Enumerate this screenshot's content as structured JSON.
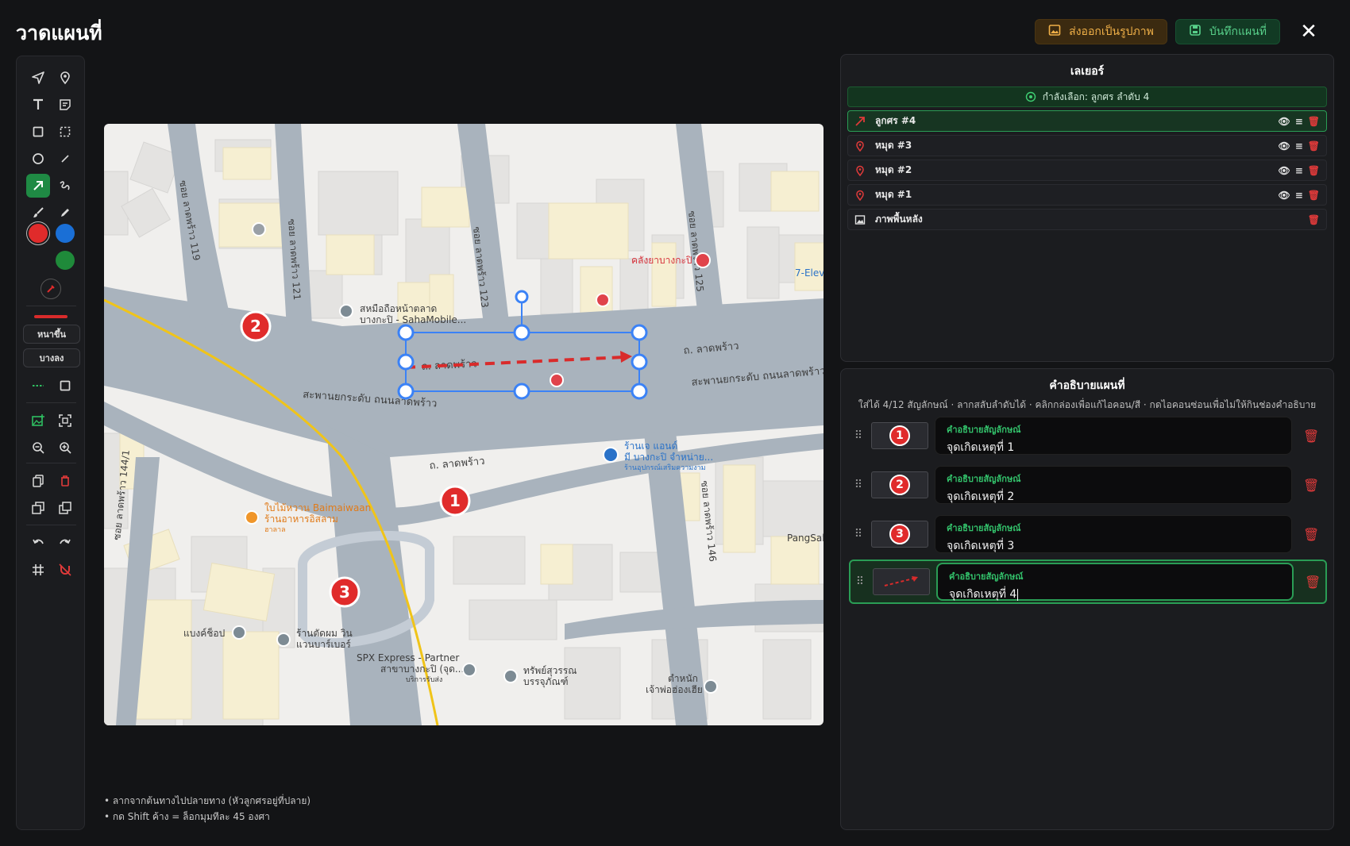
{
  "app": {
    "title": "วาดแผนที่",
    "export_label": "ส่งออกเป็นรูปภาพ",
    "save_label": "บันทึกแผนที่",
    "close_label": "✕"
  },
  "toolbar": {
    "thickness_label": "หนาขึ้น",
    "thin_label": "บางลง",
    "colors": [
      "#e02b2b",
      "#1a6fd6",
      "#1f8a3a"
    ],
    "line_color": "#d92b2b"
  },
  "hints": [
    "• ลากจากต้นทางไปปลายทาง (หัวลูกศรอยู่ที่ปลาย)",
    "• กด Shift ค้าง = ล็อกมุมทีละ 45 องศา"
  ],
  "layers": {
    "title": "เลเยอร์",
    "selected_text": "กำลังเลือก: ลูกศร ลำดับ 4",
    "items": [
      {
        "name": "ลูกศร #4",
        "icon": "arrow-icon"
      },
      {
        "name": "หมุด #3",
        "icon": "pin-icon"
      },
      {
        "name": "หมุด #2",
        "icon": "pin-icon"
      },
      {
        "name": "หมุด #1",
        "icon": "pin-icon"
      },
      {
        "name": "ภาพพื้นหลัง",
        "icon": "image-icon"
      }
    ]
  },
  "legend": {
    "title": "คำอธิบายแผนที่",
    "subtitle": "ใส่ได้ 4/12 สัญลักษณ์ · ลากสลับลำดับได้ · คลิกกล่องเพื่อแก้ไอคอน/สี · กดไอคอนซ่อนเพื่อไม่ให้กินช่องคำอธิบาย",
    "field_label": "คำอธิบายสัญลักษณ์",
    "rows": [
      {
        "badge": "1",
        "value": "จุดเกิดเหตุที่ 1"
      },
      {
        "badge": "2",
        "value": "จุดเกิดเหตุที่ 2"
      },
      {
        "badge": "3",
        "value": "จุดเกิดเหตุที่ 3"
      },
      {
        "badge": "",
        "value": "จุดเกิดเหตุที่ 4"
      }
    ]
  },
  "map": {
    "markers": [
      "1",
      "2",
      "3"
    ],
    "labels": {
      "soi119": "ซอย ลาดพร้าว 119",
      "soi121": "ซอย ลาดพร้าว 121",
      "soi123": "ซอย ลาดพร้าว 123",
      "soi125": "ซอย ลาดพร้าว 125",
      "soi144": "ซอย ลาดพร้าว 144/1",
      "soi146": "ซอย ลาดพร้าว 146",
      "road1": "ถ. ลาดพร้าว",
      "road2": "ถ. ลาดพร้าว",
      "road3": "ถ. ลาดพร้าว",
      "road4": "ถ. ลาดพร้าว",
      "bridge1": "สะพานยกระดับ ถนนลาดพร้าว",
      "bridge2": "สะพานยกระดับ ถนนลาดพร้าว",
      "saha1": "สหมือถือหน้าตลาด",
      "saha2": "บางกะปิ - SahaMobile...",
      "clinic": "คลังยาบางกะปิ",
      "seven": "7-Elev",
      "shop1": "ร้านเจ แอนด์",
      "shop2": "มี บางกะปิ จำหน่าย...",
      "shop3": "ร้านอุปกรณ์เสริมความงาม",
      "bai1": "ใบไม้หวาน Baimaiwaan",
      "bai2": "ร้านอาหารอิสลาม",
      "bai3": "ฮาลาล",
      "pang": "PangSalon",
      "bangshop": "แบงค์ช็อป",
      "barber1": "ร้านตัดผม วิน",
      "barber2": "แวนบาร์เบอร์",
      "spx1": "SPX Express - Partner",
      "spx2": "สาขาบางกะปิ (จุด...",
      "spx3": "บริการรับส่ง",
      "pawn1": "ทรัพย์สุวรรณ",
      "pawn2": "บรรจุภัณฑ์",
      "shrine1": "ตำหนัก",
      "shrine2": "เจ้าพ่อฮ่องเฮีย"
    }
  }
}
